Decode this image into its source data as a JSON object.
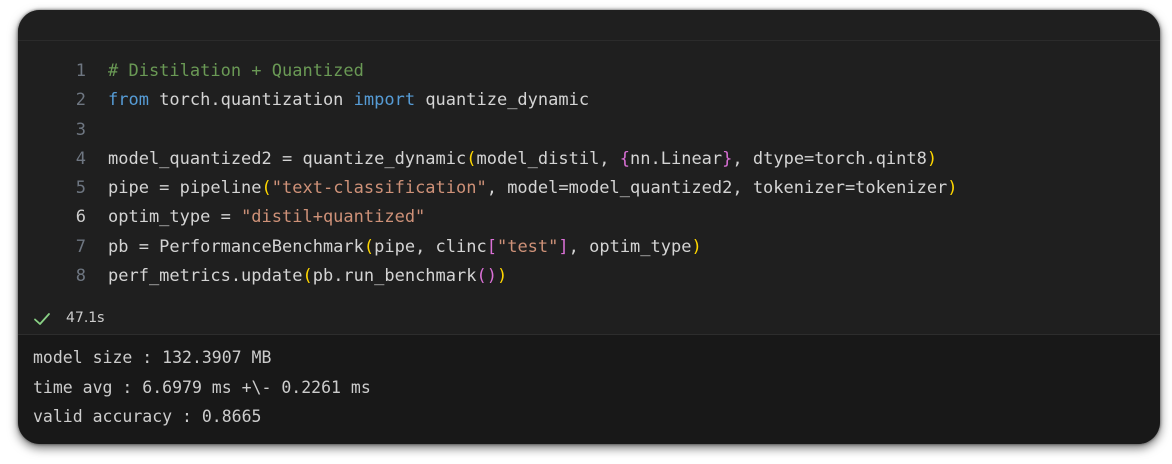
{
  "code": {
    "lines": [
      {
        "no": "1",
        "tokens": [
          {
            "cls": "t-comment",
            "text": "# Distilation + Quantized"
          }
        ]
      },
      {
        "no": "2",
        "tokens": [
          {
            "cls": "t-keyword",
            "text": "from"
          },
          {
            "cls": "t-plain",
            "text": " torch.quantization "
          },
          {
            "cls": "t-keyword",
            "text": "import"
          },
          {
            "cls": "t-plain",
            "text": " quantize_dynamic"
          }
        ]
      },
      {
        "no": "3",
        "tokens": []
      },
      {
        "no": "4",
        "tokens": [
          {
            "cls": "t-plain",
            "text": "model_quantized2 = quantize_dynamic"
          },
          {
            "cls": "t-paren",
            "text": "("
          },
          {
            "cls": "t-plain",
            "text": "model_distil, "
          },
          {
            "cls": "t-brace",
            "text": "{"
          },
          {
            "cls": "t-plain",
            "text": "nn.Linear"
          },
          {
            "cls": "t-brace",
            "text": "}"
          },
          {
            "cls": "t-plain",
            "text": ", dtype=torch.qint8"
          },
          {
            "cls": "t-paren",
            "text": ")"
          }
        ]
      },
      {
        "no": "5",
        "tokens": [
          {
            "cls": "t-plain",
            "text": "pipe = pipeline"
          },
          {
            "cls": "t-paren",
            "text": "("
          },
          {
            "cls": "t-string",
            "text": "\"text-classification\""
          },
          {
            "cls": "t-plain",
            "text": ", model=model_quantized2, tokenizer=tokenizer"
          },
          {
            "cls": "t-paren",
            "text": ")"
          }
        ]
      },
      {
        "no": "6",
        "tokens": [
          {
            "cls": "t-plain",
            "text": "optim_type = "
          },
          {
            "cls": "t-string",
            "text": "\"distil+quantized\""
          }
        ]
      },
      {
        "no": "7",
        "tokens": [
          {
            "cls": "t-plain",
            "text": "pb = PerformanceBenchmark"
          },
          {
            "cls": "t-paren",
            "text": "("
          },
          {
            "cls": "t-plain",
            "text": "pipe, clinc"
          },
          {
            "cls": "t-bracket",
            "text": "["
          },
          {
            "cls": "t-string",
            "text": "\"test\""
          },
          {
            "cls": "t-bracket",
            "text": "]"
          },
          {
            "cls": "t-plain",
            "text": ", optim_type"
          },
          {
            "cls": "t-paren",
            "text": ")"
          }
        ]
      },
      {
        "no": "8",
        "tokens": [
          {
            "cls": "t-plain",
            "text": "perf_metrics.update"
          },
          {
            "cls": "t-paren",
            "text": "("
          },
          {
            "cls": "t-plain",
            "text": "pb.run_benchmark"
          },
          {
            "cls": "t-paren2",
            "text": "()"
          },
          {
            "cls": "t-paren",
            "text": ")"
          }
        ]
      }
    ],
    "active_line": "6"
  },
  "status": {
    "icon": "check-icon",
    "icon_color": "#89d185",
    "time": "47.1s"
  },
  "output": {
    "lines": [
      "model size : 132.3907 MB",
      "time avg : 6.6979 ms +\\- 0.2261 ms",
      "valid accuracy : 0.8665"
    ]
  }
}
